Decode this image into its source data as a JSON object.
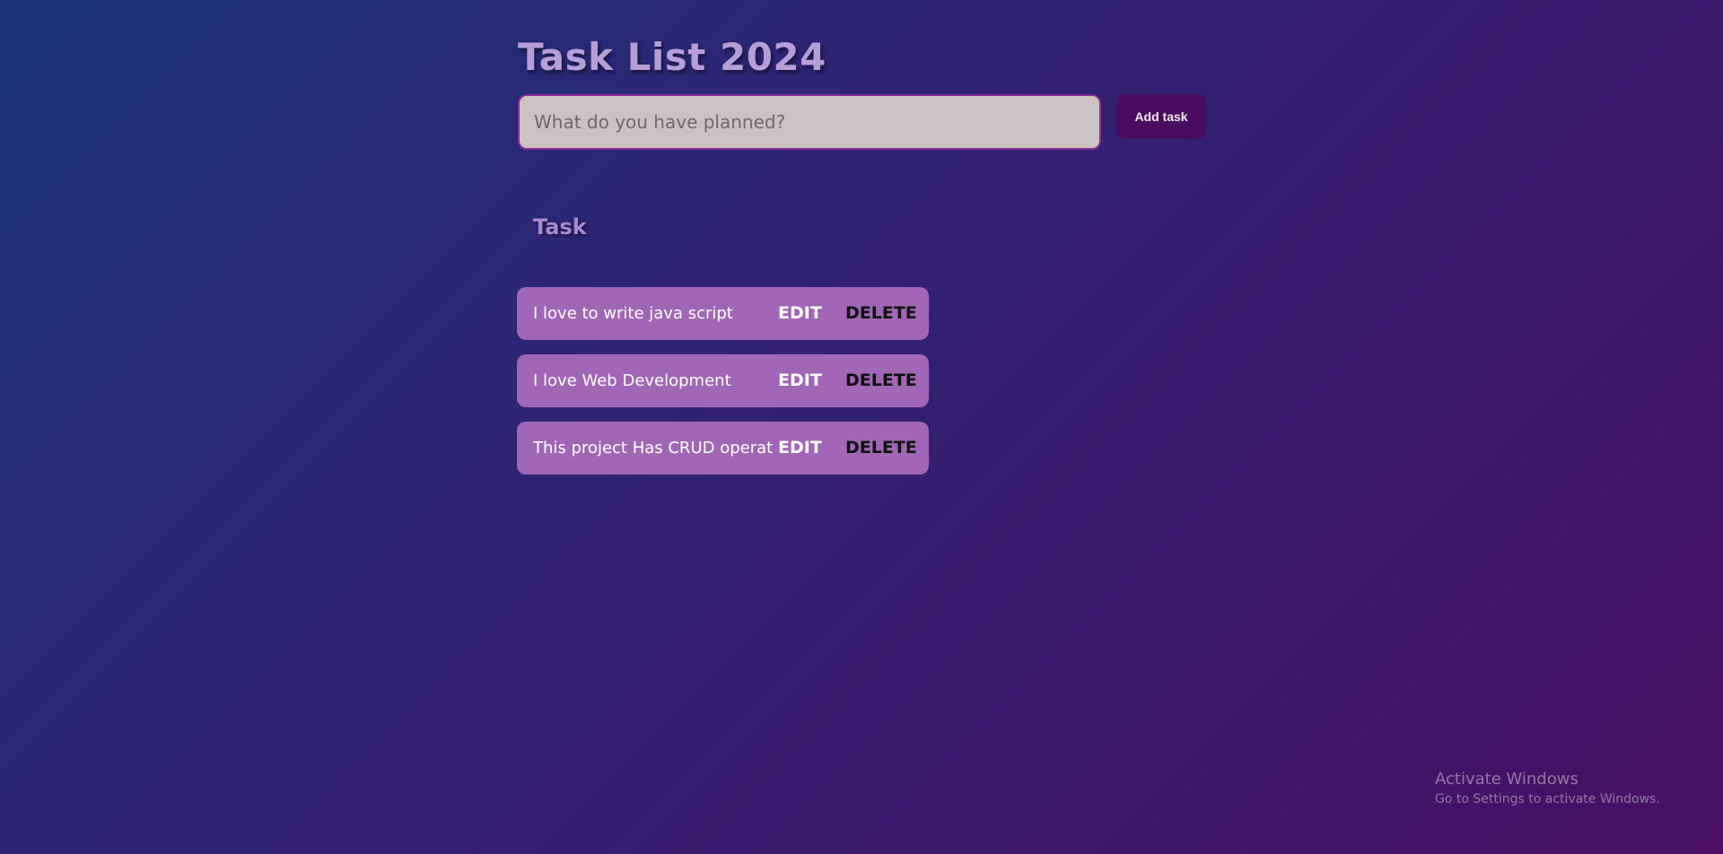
{
  "header": {
    "title": "Task List 2024"
  },
  "form": {
    "placeholder": "What do you have planned?",
    "add_label": "Add task"
  },
  "section": {
    "title": "Task"
  },
  "tasks": [
    {
      "text": "I love to write java script",
      "edit_label": "EDIT",
      "delete_label": "DELETE"
    },
    {
      "text": "I love Web Development",
      "edit_label": "EDIT",
      "delete_label": "DELETE"
    },
    {
      "text": "This project Has CRUD operatic",
      "edit_label": "EDIT",
      "delete_label": "DELETE"
    }
  ],
  "watermark": {
    "title": "Activate Windows",
    "subtitle": "Go to Settings to activate Windows."
  },
  "colors": {
    "task_bg": "#a266b6",
    "button_bg": "#4a0c5e",
    "input_bg": "#ccc2c3",
    "title_color": "#b59fd6"
  }
}
